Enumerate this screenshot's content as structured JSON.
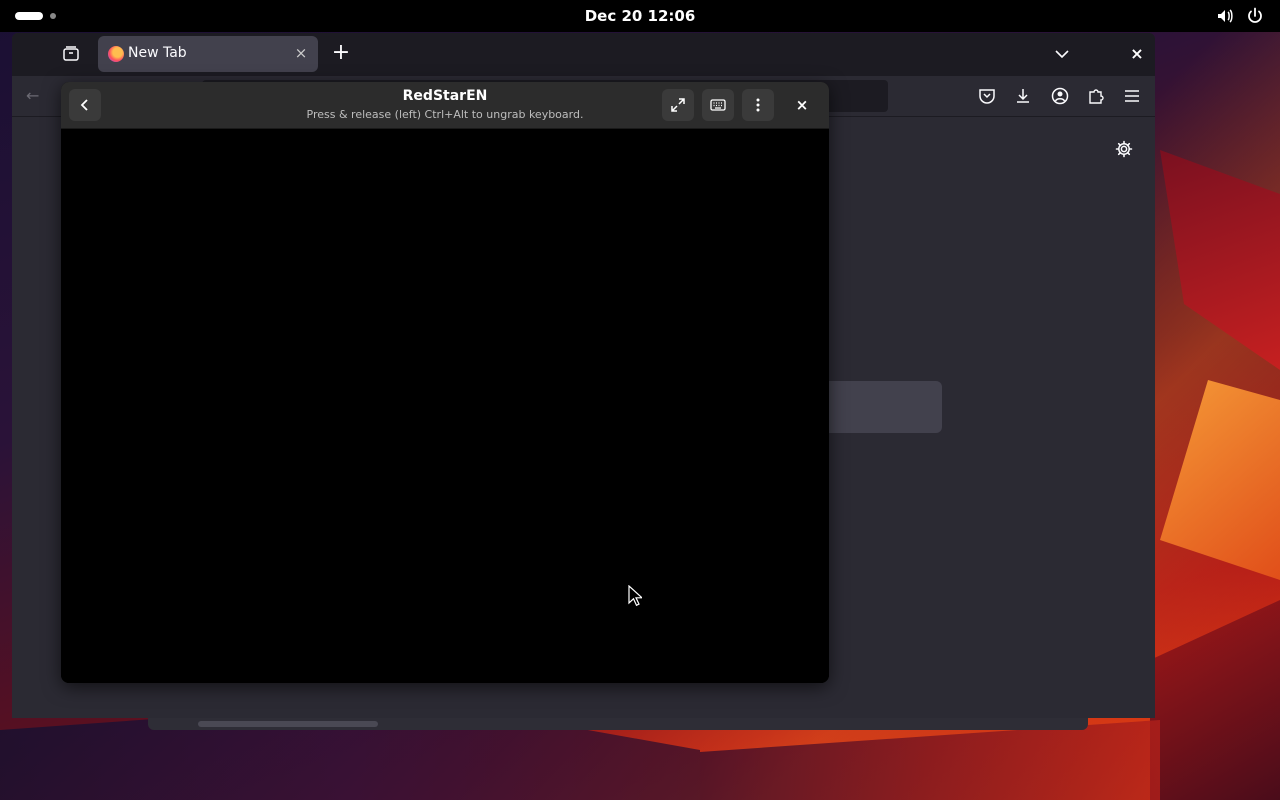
{
  "topbar": {
    "clock": "Dec 20  12:06",
    "icons": [
      "volume-icon",
      "power-icon"
    ]
  },
  "browser": {
    "tabs": [
      {
        "title": "New Tab",
        "active": true
      }
    ],
    "icons": {
      "tab_overview": "tab-overview-icon",
      "new_tab": "+",
      "tab_close": "×",
      "list_all_tabs": "chevron-down-icon",
      "window_close": "×",
      "back": "←",
      "toolbar": [
        "pocket-icon",
        "download-icon",
        "account-icon",
        "extensions-icon",
        "menu-icon"
      ],
      "settings": "gear-icon"
    }
  },
  "viewer": {
    "title": "RedStarEN",
    "subtitle": "Press & release (left) Ctrl+Alt to ungrab keyboard.",
    "close": "×",
    "icons": [
      "back-icon",
      "fullscreen-icon",
      "keyboard-icon",
      "more-icon"
    ]
  },
  "colors": {
    "topbar": "#000000",
    "browser_bg": "#2b2a33",
    "tabstrip": "#1c1b22",
    "active_tab": "#42414d",
    "viewer_header": "#2c2c2c"
  }
}
